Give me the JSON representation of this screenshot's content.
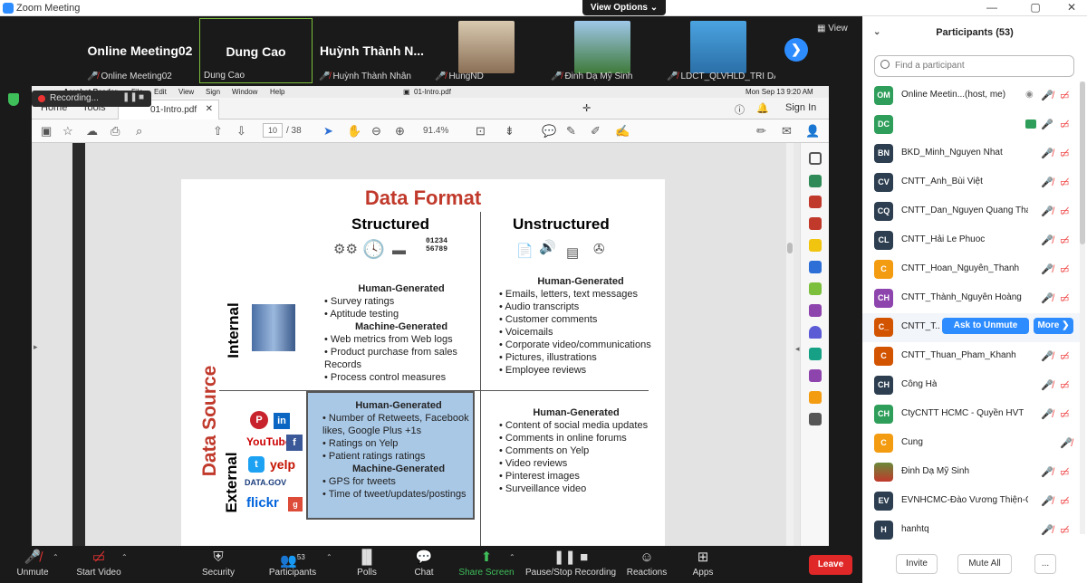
{
  "window": {
    "title": "Zoom Meeting",
    "view_options": "View Options ⌄",
    "view_label": "View"
  },
  "thumbnails": [
    {
      "big": "Online Meeting02",
      "name": "Online Meeting02"
    },
    {
      "big": "Dung Cao",
      "name": "Dung Cao"
    },
    {
      "big": "Huỳnh Thành N...",
      "name": "Huỳnh Thành Nhân"
    },
    {
      "big": "",
      "name": "HungND"
    },
    {
      "big": "",
      "name": "Đinh Dạ Mỹ Sinh"
    },
    {
      "big": "",
      "name": "LDCT_QLVHLD_TRI DA..."
    }
  ],
  "recording": {
    "label": "Recording..."
  },
  "mac": {
    "app": "Acrobat Reader",
    "menu": [
      "File",
      "Edit",
      "View",
      "Sign",
      "Window",
      "Help"
    ],
    "doc": "01-Intro.pdf",
    "clock": "Mon Sep 13  9:20 AM"
  },
  "acrobat": {
    "home": "Home",
    "tools": "Tools",
    "tab": "01-Intro.pdf",
    "signin": "Sign In",
    "page": "10",
    "pages": "/ 38",
    "zoom": "91.4%"
  },
  "slide": {
    "title": "Data Format",
    "col1": "Structured",
    "col2": "Unstructured",
    "data_source": "Data Source",
    "internal": "Internal",
    "external": "External",
    "digits1": "01234",
    "digits2": "56789",
    "q1": {
      "h1": "Human-Generated",
      "items1": [
        "Survey ratings",
        "Aptitude testing"
      ],
      "h2": "Machine-Generated",
      "items2": [
        "Web metrics from Web logs",
        "Product purchase from sales Records",
        "Process control measures"
      ]
    },
    "q2": {
      "h1": "Human-Generated",
      "items1": [
        "Emails, letters, text messages",
        "Audio transcripts",
        "Customer comments",
        "Voicemails",
        "Corporate video/communications",
        "Pictures, illustrations",
        "Employee reviews"
      ]
    },
    "q3": {
      "h1": "Human-Generated",
      "items1": [
        "Number of Retweets, Facebook likes, Google Plus +1s",
        "Ratings on Yelp",
        "Patient ratings ratings"
      ],
      "h2": "Machine-Generated",
      "items2": [
        "GPS for tweets",
        "Time of tweet/updates/postings"
      ]
    },
    "q4": {
      "h1": "Human-Generated",
      "items1": [
        "Content of social media updates",
        "Comments in online forums",
        "Comments on Yelp",
        "Video reviews",
        "Pinterest images",
        "Surveillance video"
      ]
    },
    "logos": {
      "youtube": "YouTube",
      "yelp": "yelp",
      "datagov": "DATA.GOV",
      "flickr": "flickr"
    }
  },
  "participants": {
    "title": "Participants (53)",
    "search_placeholder": "Find a participant",
    "ask_unmute": "Ask to Unmute",
    "more": "More ❯",
    "list": [
      {
        "initials": "OM",
        "name": "Online Meetin...(host, me)",
        "color": "#2e9e5a"
      },
      {
        "initials": "DC",
        "name": "",
        "color": "#2e9e5a"
      },
      {
        "initials": "BN",
        "name": "BKD_Minh_Nguyen Nhat",
        "color": "#2c3e50"
      },
      {
        "initials": "CV",
        "name": "CNTT_Anh_Bùi Việt",
        "color": "#2c3e50"
      },
      {
        "initials": "CQ",
        "name": "CNTT_Dan_Nguyen Quang Thai",
        "color": "#2c3e50"
      },
      {
        "initials": "CL",
        "name": "CNTT_Hải Le Phuoc",
        "color": "#2c3e50"
      },
      {
        "initials": "C",
        "name": "CNTT_Hoan_Nguyễn_Thanh",
        "color": "#f39c12"
      },
      {
        "initials": "CH",
        "name": "CNTT_Thành_Nguyễn Hoàng",
        "color": "#8e44ad"
      },
      {
        "initials": "C_",
        "name": "CNTT_T...",
        "color": "#d35400"
      },
      {
        "initials": "C",
        "name": "CNTT_Thuan_Pham_Khanh",
        "color": "#d35400"
      },
      {
        "initials": "CH",
        "name": "Công Hà",
        "color": "#2c3e50"
      },
      {
        "initials": "CH",
        "name": "CtyCNTT HCMC - Quyền HVT",
        "color": "#2e9e5a"
      },
      {
        "initials": "C",
        "name": "Cung",
        "color": "#f39c12"
      },
      {
        "initials": "",
        "name": "Đinh Dạ Mỹ Sinh",
        "color": "#6a8a3a"
      },
      {
        "initials": "EV",
        "name": "EVNHCMC-Đào Vương Thiện-CV",
        "color": "#2c3e50"
      },
      {
        "initials": "H",
        "name": "hanhtq",
        "color": "#2c3e50"
      }
    ],
    "invite": "Invite",
    "mute_all": "Mute All",
    "more_dots": "..."
  },
  "toolbar": {
    "unmute": "Unmute",
    "start_video": "Start Video",
    "security": "Security",
    "participants": "Participants",
    "participants_count": "53",
    "polls": "Polls",
    "chat": "Chat",
    "share": "Share Screen",
    "pause": "Pause/Stop Recording",
    "reactions": "Reactions",
    "apps": "Apps",
    "leave": "Leave"
  }
}
